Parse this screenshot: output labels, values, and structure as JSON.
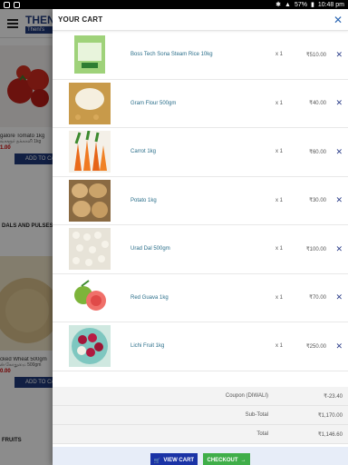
{
  "statusbar": {
    "battery": "57%",
    "time": "10:48 pm"
  },
  "background": {
    "brand": "THENI",
    "tagline": "Theni's",
    "products": [
      {
        "name": "galore Tomato 1kg",
        "sub": "ங்களூர் தக்காளி 1kg",
        "price": "1.00",
        "add": "ADD TO CA"
      },
      {
        "name": "cked Wheat 500gm",
        "sub": "ன் கோதுமை 500gm",
        "price": "0.00",
        "add": "ADD TO CA"
      }
    ],
    "sections": [
      "DALS AND PULSES",
      "FRUITS"
    ]
  },
  "cart": {
    "title": "YOUR CART",
    "items": [
      {
        "name": "Boss Tech Sona Steam Rice 10kg",
        "qty": "x 1",
        "price": "₹510.00"
      },
      {
        "name": "Gram Flour 500gm",
        "qty": "x 1",
        "price": "₹40.00"
      },
      {
        "name": "Carrot 1kg",
        "qty": "x 1",
        "price": "₹60.00"
      },
      {
        "name": "Potato 1kg",
        "qty": "x 1",
        "price": "₹30.00"
      },
      {
        "name": "Urad Dal 500gm",
        "qty": "x 1",
        "price": "₹100.00"
      },
      {
        "name": "Red Guava 1kg",
        "qty": "x 1",
        "price": "₹70.00"
      },
      {
        "name": "Lichi Fruit 1kg",
        "qty": "x 1",
        "price": "₹250.00"
      }
    ],
    "summary": {
      "coupon_label": "Coupon (DIWALI)",
      "coupon_value": "₹-23.40",
      "subtotal_label": "Sub-Total",
      "subtotal_value": "₹1,170.00",
      "total_label": "Total",
      "total_value": "₹1,146.60"
    },
    "buttons": {
      "view_cart": "VIEW CART",
      "checkout": "CHECKOUT"
    }
  },
  "colors": {
    "accent": "#1a33a6",
    "checkout": "#3fae49",
    "link": "#2a6e8a"
  }
}
